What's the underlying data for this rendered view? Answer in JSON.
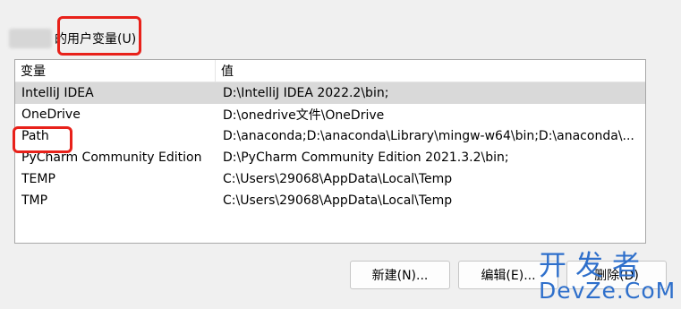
{
  "group": {
    "title": "的用户变量(U)"
  },
  "columns": {
    "name": "变量",
    "value": "值"
  },
  "rows": [
    {
      "name": "IntelliJ IDEA",
      "value": "D:\\IntelliJ IDEA 2022.2\\bin;"
    },
    {
      "name": "OneDrive",
      "value": "D:\\onedrive文件\\OneDrive"
    },
    {
      "name": "Path",
      "value": "D:\\anaconda;D:\\anaconda\\Library\\mingw-w64\\bin;D:\\anaconda\\..."
    },
    {
      "name": "PyCharm Community Edition",
      "value": "D:\\PyCharm Community Edition 2021.3.2\\bin;"
    },
    {
      "name": "TEMP",
      "value": "C:\\Users\\29068\\AppData\\Local\\Temp"
    },
    {
      "name": "TMP",
      "value": "C:\\Users\\29068\\AppData\\Local\\Temp"
    }
  ],
  "buttons": {
    "new": "新建(N)...",
    "edit": "编辑(E)...",
    "delete": "删除(D)"
  },
  "watermark": {
    "line1": "开发者",
    "line2": "DevZe.CoM"
  },
  "colors": {
    "highlight": "#e8211a",
    "watermark": "#2e6fcb"
  }
}
